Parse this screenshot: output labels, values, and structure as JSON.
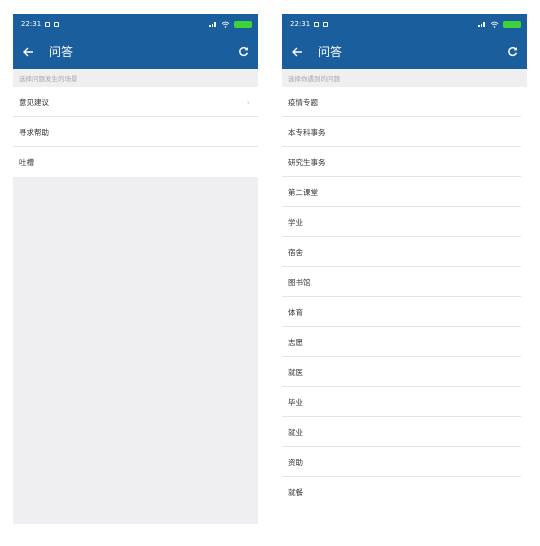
{
  "left_screen": {
    "status_bar": {
      "time": "22:31"
    },
    "app_bar": {
      "title": "问答"
    },
    "hint": "选择问题发生的场景",
    "items": [
      {
        "label": "意见建议",
        "chevron": "›"
      },
      {
        "label": "寻求帮助"
      },
      {
        "label": "吐槽"
      }
    ]
  },
  "right_screen": {
    "status_bar": {
      "time": "22:31"
    },
    "app_bar": {
      "title": "问答"
    },
    "hint": "选择你遇到的问题",
    "items": [
      {
        "label": "疫情专题"
      },
      {
        "label": "本专科事务"
      },
      {
        "label": "研究生事务"
      },
      {
        "label": "第二课堂"
      },
      {
        "label": "学业"
      },
      {
        "label": "宿舍"
      },
      {
        "label": "图书馆"
      },
      {
        "label": "体育"
      },
      {
        "label": "志愿"
      },
      {
        "label": "就医"
      },
      {
        "label": "毕业"
      },
      {
        "label": "就业"
      },
      {
        "label": "资助"
      },
      {
        "label": "就餐"
      }
    ]
  },
  "colors": {
    "brand": "#1a5e9e",
    "background": "#efeff2",
    "divider": "#e4e4e6",
    "battery": "#3dd13b"
  },
  "icons": {
    "back": "arrow-left-icon",
    "refresh": "refresh-icon",
    "chevron": "chevron-right-icon"
  }
}
